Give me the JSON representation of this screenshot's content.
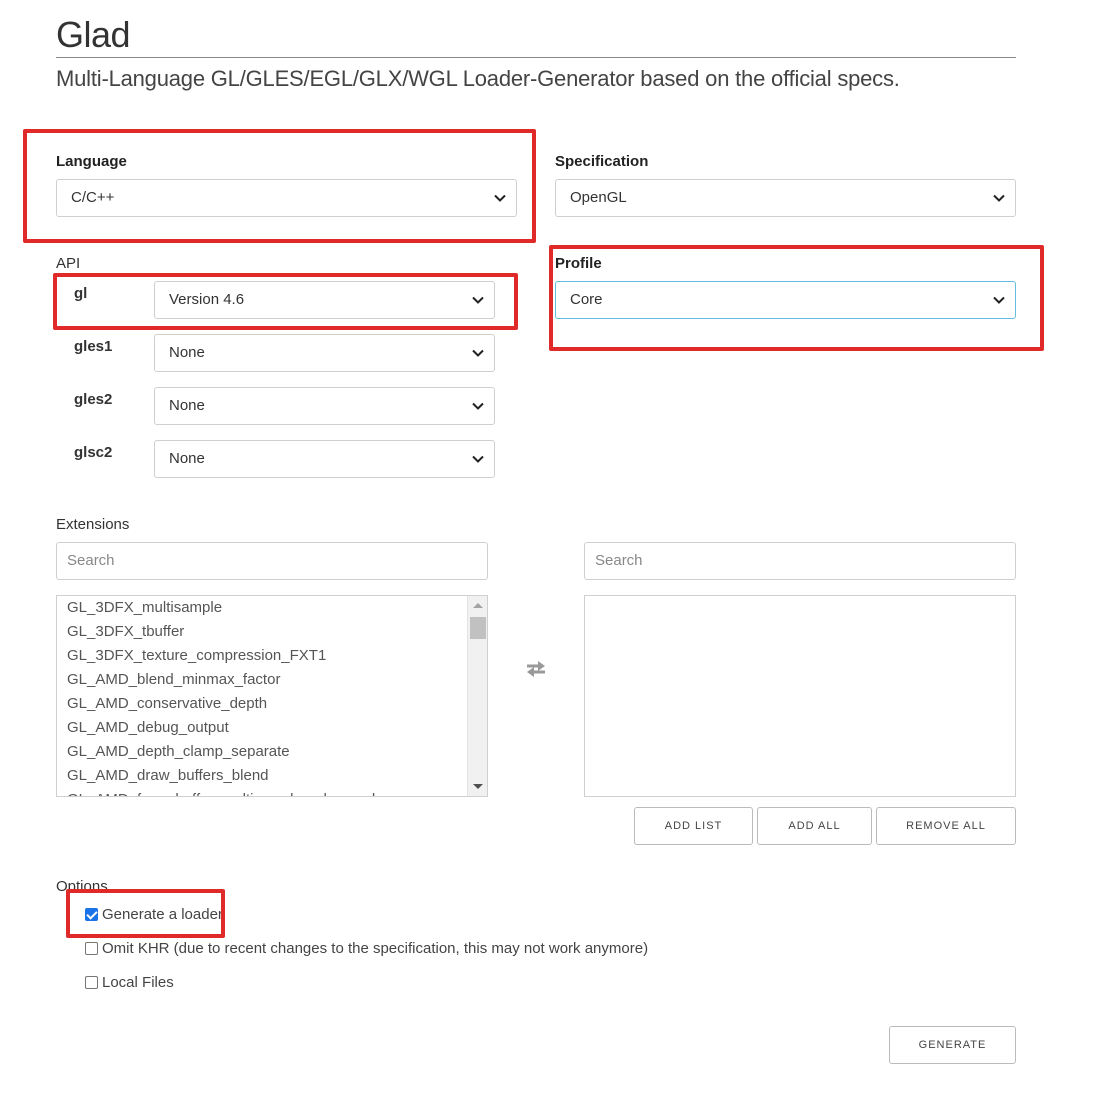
{
  "header": {
    "title": "Glad",
    "subtitle": "Multi-Language GL/GLES/EGL/GLX/WGL Loader-Generator based on the official specs."
  },
  "language": {
    "label": "Language",
    "value": "C/C++"
  },
  "specification": {
    "label": "Specification",
    "value": "OpenGL"
  },
  "api": {
    "label": "API",
    "rows": [
      {
        "name": "gl",
        "value": "Version 4.6"
      },
      {
        "name": "gles1",
        "value": "None"
      },
      {
        "name": "gles2",
        "value": "None"
      },
      {
        "name": "glsc2",
        "value": "None"
      }
    ]
  },
  "profile": {
    "label": "Profile",
    "value": "Core"
  },
  "extensions": {
    "label": "Extensions",
    "left_search_placeholder": "Search",
    "right_search_placeholder": "Search",
    "items": [
      "GL_3DFX_multisample",
      "GL_3DFX_tbuffer",
      "GL_3DFX_texture_compression_FXT1",
      "GL_AMD_blend_minmax_factor",
      "GL_AMD_conservative_depth",
      "GL_AMD_debug_output",
      "GL_AMD_depth_clamp_separate",
      "GL_AMD_draw_buffers_blend",
      "GL_AMD_framebuffer_multisample_advanced"
    ],
    "buttons": {
      "add_list": "ADD LIST",
      "add_all": "ADD ALL",
      "remove_all": "REMOVE ALL"
    }
  },
  "options": {
    "label": "Options",
    "items": [
      {
        "label": "Generate a loader",
        "checked": true
      },
      {
        "label": "Omit KHR (due to recent changes to the specification, this may not work anymore)",
        "checked": false
      },
      {
        "label": "Local Files",
        "checked": false
      }
    ]
  },
  "generate_label": "GENERATE",
  "icons": {
    "dropdown": "chevron-down-icon",
    "swap": "swap-arrows-icon",
    "checkbox": "checkbox-icon"
  },
  "colors": {
    "highlight": "#e02a2a",
    "focus": "#66bbe0",
    "checkbox": "#1a73e8"
  }
}
